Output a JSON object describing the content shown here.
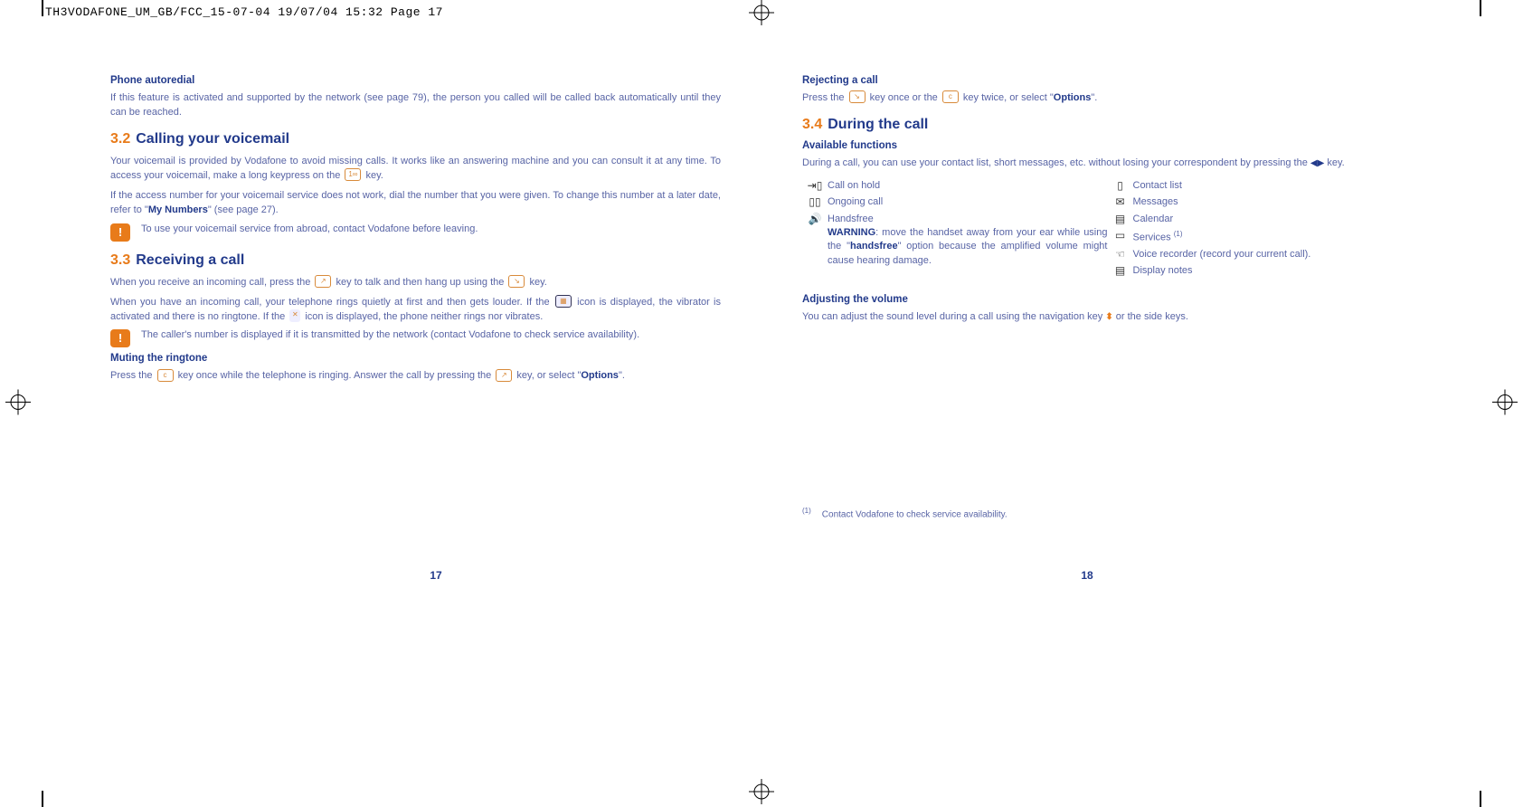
{
  "header_slug": "TH3VODAFONE_UM_GB/FCC_15-07-04  19/07/04  15:32  Page 17",
  "left": {
    "h_autoredial": "Phone autoredial",
    "p_autoredial": "If this feature is activated and supported by the network (see page 79), the person you called will be called back automatically until they can be reached.",
    "sec32_num": "3.2",
    "sec32_title": "Calling your voicemail",
    "p_vm1": "Your voicemail is provided by Vodafone to avoid missing calls. It works like an answering machine and you can consult it at any time. To access your voicemail, make a long keypress on the ",
    "p_vm1_tail": " key.",
    "p_vm2_a": "If the access number for your voicemail service does not work, dial the number that you were given. To change this number at a later date, refer to \"",
    "p_vm2_bold": "My Numbers",
    "p_vm2_b": "\" (see page 27).",
    "note1": "To use your voicemail service from abroad, contact Vodafone before leaving.",
    "sec33_num": "3.3",
    "sec33_title": "Receiving a call",
    "p_recv1_a": "When you receive an incoming call, press the ",
    "p_recv1_b": " key to talk and then hang up using the ",
    "p_recv1_c": " key.",
    "p_recv2_a": "When you have an incoming call, your telephone rings quietly at first and then gets louder. If the ",
    "p_recv2_b": " icon is displayed, the vibrator is activated and there is no ringtone. If the ",
    "p_recv2_c": " icon is displayed, the phone neither rings nor vibrates.",
    "note2": "The caller's number is displayed if it is transmitted by the network (contact Vodafone to check service availability).",
    "h_mute": "Muting the ringtone",
    "p_mute_a": "Press the ",
    "p_mute_b": " key once while the telephone is ringing. Answer the call by pressing the ",
    "p_mute_c": " key, or select \"",
    "p_mute_bold": "Options",
    "p_mute_d": "\".",
    "page_num": "17"
  },
  "right": {
    "h_reject": "Rejecting a call",
    "p_reject_a": "Press the ",
    "p_reject_b": " key once or the ",
    "p_reject_c": " key twice, or select \"",
    "p_reject_bold": "Options",
    "p_reject_d": "\".",
    "sec34_num": "3.4",
    "sec34_title": "During the call",
    "h_avail": "Available functions",
    "p_avail_a": "During a call, you can use your contact list, short messages, etc. without losing your correspondent by pressing the ",
    "p_avail_b": " key.",
    "func_left": {
      "hold": "Call on hold",
      "ongoing": "Ongoing call",
      "hf_title": "Handsfree",
      "hf_warn_label": "WARNING",
      "hf_warn_a": ": move the handset away from your ear while using the \"",
      "hf_warn_bold": "handsfree",
      "hf_warn_b": "\" option because the amplified volume might cause hearing damage."
    },
    "func_right": {
      "contacts": "Contact list",
      "messages": "Messages",
      "calendar": "Calendar",
      "services": "Services ",
      "services_sup": "(1)",
      "recorder": "Voice recorder (record your current call).",
      "notes": "Display notes"
    },
    "h_vol": "Adjusting the volume",
    "p_vol_a": "You can adjust the sound level during a call using the navigation key ",
    "p_vol_b": " or the side keys.",
    "footnote_sup": "(1)",
    "footnote": "Contact Vodafone to check service availability.",
    "page_num": "18"
  }
}
